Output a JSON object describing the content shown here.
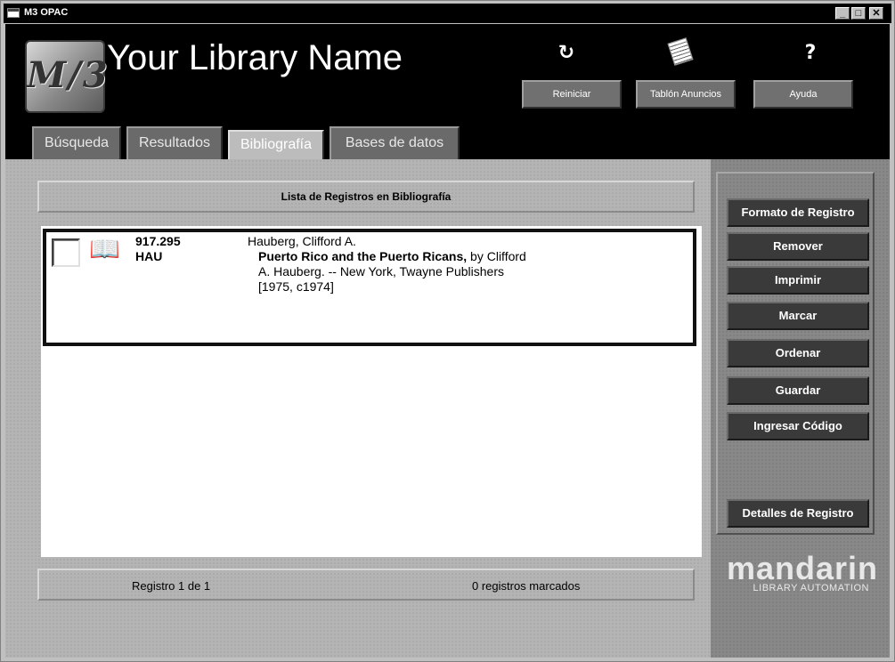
{
  "window": {
    "title": "M3 OPAC",
    "controls": {
      "minimize": "_",
      "maximize": "□",
      "close": "✕"
    }
  },
  "header": {
    "library_name": "Your Library Name",
    "logo_text": "M/3",
    "buttons": {
      "restart": "Reiniciar",
      "notice_board": "Tablón Anuncios",
      "help": "Ayuda"
    },
    "icons": {
      "restart": "restart-icon",
      "notice_board": "notice-icon",
      "help": "question-icon"
    },
    "help_glyph": "?",
    "restart_glyph": "↻"
  },
  "tabs": [
    {
      "label": "Búsqueda",
      "active": false
    },
    {
      "label": "Resultados",
      "active": false
    },
    {
      "label": "Bibliografía",
      "active": true
    },
    {
      "label": "Bases de datos",
      "active": false
    }
  ],
  "main": {
    "list_header": "Lista de Registros en Bibliografía",
    "records": [
      {
        "checked": false,
        "icon": "book-icon",
        "call_number_1": "917.295",
        "call_number_2": "HAU",
        "author": "Hauberg, Clifford A.",
        "title": "Puerto Rico and the Puerto Ricans,",
        "byline": "by Clifford",
        "line3": "A. Hauberg.  -- New York, Twayne Publishers",
        "line4": "[1975, c1974]"
      }
    ],
    "status": {
      "record_position": "Registro 1 de 1",
      "marked": "0 registros marcados"
    }
  },
  "sidebar": {
    "buttons": [
      "Formato de Registro",
      "Remover",
      "Imprimir",
      "Marcar",
      "Ordenar",
      "Guardar",
      "Ingresar Código",
      "Detalles de Registro"
    ]
  },
  "brand": {
    "name": "mandarin",
    "tagline": "LIBRARY AUTOMATION"
  }
}
